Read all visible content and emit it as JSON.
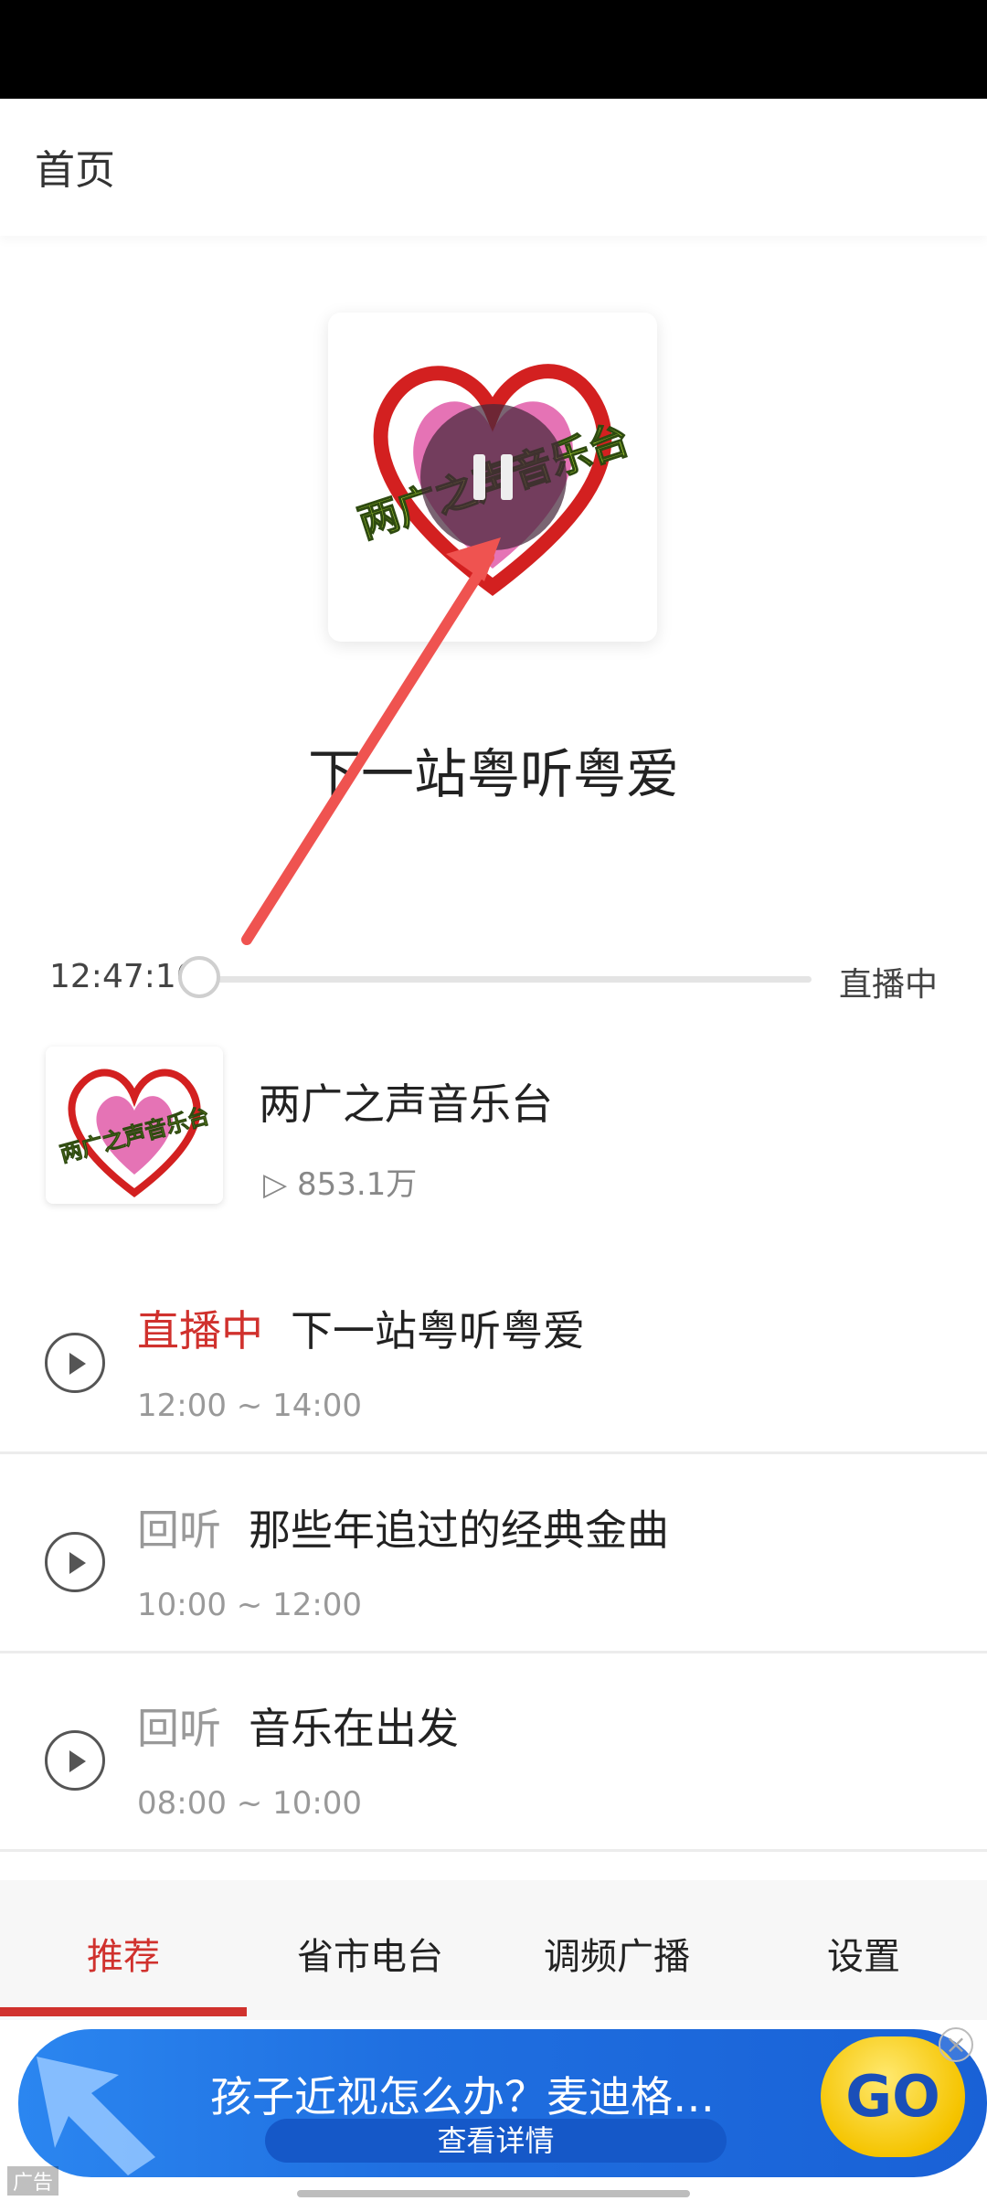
{
  "header": {
    "title": "首页"
  },
  "player": {
    "cover_text": "两广之声音乐台",
    "program_title": "下一站粤听粤爱",
    "current_time": "12:47:10",
    "live_label": "直播中",
    "progress": 0.0
  },
  "station": {
    "name": "两广之声音乐台",
    "play_count": "▷ 853.1万",
    "thumb_text": "两广之声音乐台"
  },
  "schedule": [
    {
      "tag": "直播中",
      "title": "下一站粤听粤爱",
      "time": "12:00 ~ 14:00",
      "tag_color": "#d0312d"
    },
    {
      "tag": "回听",
      "title": "那些年追过的经典金曲",
      "time": "10:00 ~ 12:00",
      "tag_color": "#999999"
    },
    {
      "tag": "回听",
      "title": "音乐在出发",
      "time": "08:00 ~ 10:00",
      "tag_color": "#999999"
    }
  ],
  "tabs": [
    {
      "label": "推荐",
      "active": true
    },
    {
      "label": "省市电台",
      "active": false
    },
    {
      "label": "调频广播",
      "active": false
    },
    {
      "label": "设置",
      "active": false
    }
  ],
  "ad": {
    "headline": "孩子近视怎么办？麦迪格…",
    "button": "查看详情",
    "go": "GO",
    "mark": "广告"
  },
  "colors": {
    "accent": "#d0312d",
    "ad_blue": "#1f6fe0",
    "annotation_arrow": "#ef5350"
  }
}
